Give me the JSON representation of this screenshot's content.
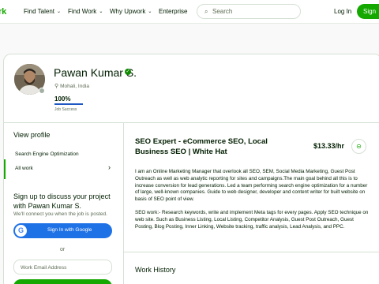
{
  "nav": {
    "logo": "rk",
    "links": [
      "Find Talent",
      "Find Work",
      "Why Upwork",
      "Enterprise"
    ],
    "search_placeholder": "Search",
    "login": "Log In",
    "signup": "Sign"
  },
  "profile": {
    "name": "Pawan Kumar S.",
    "location": "Mohali, India",
    "job_success_pct": "100%",
    "job_success_label": "Job Success"
  },
  "sidebar": {
    "view_profile": "View profile",
    "items": [
      "Search Engine Optimization",
      "All work"
    ],
    "cta_title": "Sign up to discuss your project with Pawan Kumar S.",
    "cta_sub": "We'll connect you when the job is posted.",
    "google_btn": "Sign In with Google",
    "or": "or",
    "email_placeholder": "Work Email Address"
  },
  "main": {
    "title": "SEO Expert - eCommerce SEO, Local Business SEO | White Hat",
    "rate": "$13.33/hr",
    "desc_p1": "I am an Online Marketing Manager that overlook all SEO, SEM, Social Media Marketing, Guest Post Outreach as well as web analytic reporting for sites and campaigns.The main goal behind all this is to increase conversion for lead generations. Led a team performing search engine optimization for a number of large, well-known companies. Guide to web designer, developer and content writer for built website on basis of SEO point of view.",
    "desc_p2": "SEO work:- Research keywords, write and implement Meta tags for every pages. Apply SEO technique on web site. Such as Business Listing, Local Listing, Competitor Analysis, Guest Post Outreach, Guest Posting, Blog Posting, Inner Linking, Website tracking, traffic analysis, Lead Analysis, and PPC.",
    "work_history": "Work History"
  },
  "colors": {
    "brand_green": "#14a800",
    "google_blue": "#1f71e6",
    "success_bar": "#1f57c3"
  },
  "icons": [
    "search-icon",
    "location-pin-icon",
    "verified-badge-icon",
    "chevron-right-icon",
    "link-icon",
    "google-icon"
  ]
}
